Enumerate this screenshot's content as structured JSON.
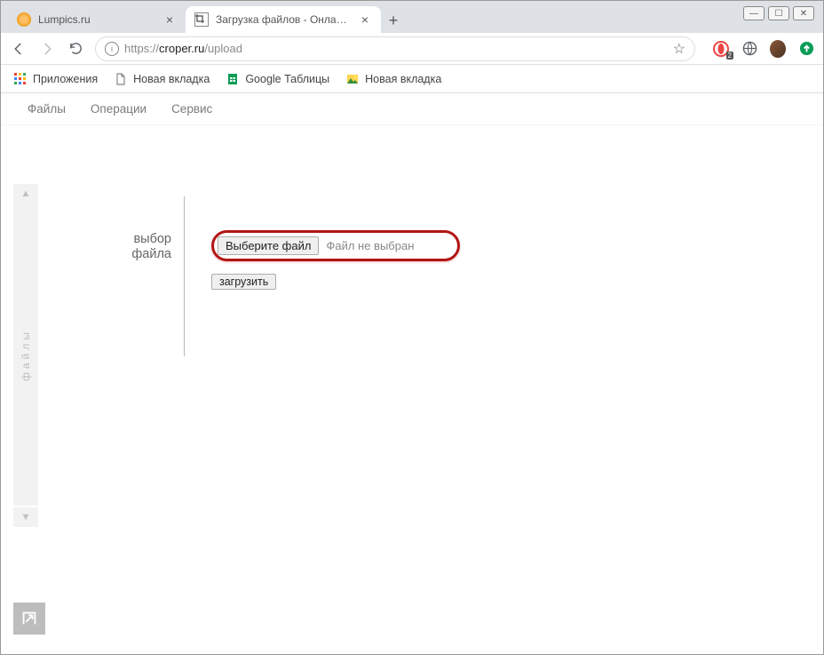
{
  "window": {
    "min": "—",
    "max": "☐",
    "close": "✕"
  },
  "tabs": [
    {
      "title": "Lumpics.ru",
      "active": false,
      "favicon": "#f39c12"
    },
    {
      "title": "Загрузка файлов - Онлайн фото",
      "active": true,
      "favicon": "#888"
    }
  ],
  "address": {
    "scheme": "https://",
    "host": "croper.ru",
    "path": "/upload"
  },
  "ext_badge": "2",
  "bookmarks": [
    {
      "icon": "apps",
      "label": "Приложения"
    },
    {
      "icon": "page",
      "label": "Новая вкладка"
    },
    {
      "icon": "sheets",
      "label": "Google Таблицы"
    },
    {
      "icon": "pic",
      "label": "Новая вкладка"
    }
  ],
  "site_menu": [
    "Файлы",
    "Операции",
    "Сервис"
  ],
  "side_label": "файлы",
  "upload": {
    "label_line1": "выбор",
    "label_line2": "файла",
    "choose_btn": "Выберите файл",
    "no_file": "Файл не выбран",
    "submit": "загрузить"
  }
}
